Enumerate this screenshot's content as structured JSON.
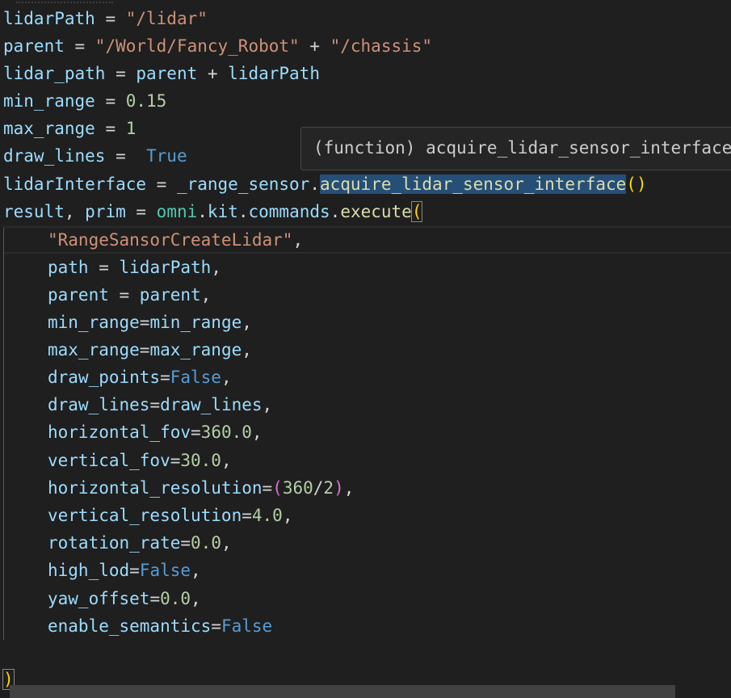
{
  "code": {
    "l1": {
      "var": "lidarPath",
      "eq": " = ",
      "val": "\"/lidar\""
    },
    "l2": {
      "var": "parent",
      "eq": " = ",
      "s1": "\"/World/Fancy_Robot\"",
      "plus": " + ",
      "s2": "\"/chassis\""
    },
    "l3": {
      "var": "lidar_path",
      "eq": " = ",
      "a": "parent",
      "plus": " + ",
      "b": "lidarPath"
    },
    "l4": {
      "var": "min_range",
      "eq": " = ",
      "val": "0.15"
    },
    "l5": {
      "var": "max_range",
      "eq": " = ",
      "val": "1"
    },
    "l6": {
      "var": "draw_lines",
      "eq": " =  ",
      "val": "True"
    },
    "l7": {
      "var": "lidarInterface",
      "eq": " = ",
      "obj": "_range_sensor",
      "dot": ".",
      "fn": "acquire_lidar_sensor_interface",
      "open": "(",
      "close": ")"
    },
    "l8": {
      "a": "result",
      "comma": ", ",
      "b": "prim",
      "eq": " = ",
      "m1": "omni",
      "d1": ".",
      "m2": "kit",
      "d2": ".",
      "m3": "commands",
      "d3": ".",
      "fn": "execute",
      "open": "("
    },
    "l9": {
      "str": "\"RangeSansorCreateLidar\"",
      "comma": ","
    },
    "l10": {
      "key": "path",
      "eq": " = ",
      "val": "lidarPath",
      "comma": ","
    },
    "l11": {
      "key": "parent",
      "eq": " = ",
      "val": "parent",
      "comma": ","
    },
    "l12": {
      "key": "min_range",
      "eq": "=",
      "val": "min_range",
      "comma": ","
    },
    "l13": {
      "key": "max_range",
      "eq": "=",
      "val": "max_range",
      "comma": ","
    },
    "l14": {
      "key": "draw_points",
      "eq": "=",
      "val": "False",
      "comma": ","
    },
    "l15": {
      "key": "draw_lines",
      "eq": "=",
      "val": "draw_lines",
      "comma": ","
    },
    "l16": {
      "key": "horizontal_fov",
      "eq": "=",
      "val": "360.0",
      "comma": ","
    },
    "l17": {
      "key": "vertical_fov",
      "eq": "=",
      "val": "30.0",
      "comma": ","
    },
    "l18": {
      "key": "horizontal_resolution",
      "eq": "=",
      "open": "(",
      "n1": "360",
      "slash": "/",
      "n2": "2",
      "close": ")",
      "comma": ","
    },
    "l19": {
      "key": "vertical_resolution",
      "eq": "=",
      "val": "4.0",
      "comma": ","
    },
    "l20": {
      "key": "rotation_rate",
      "eq": "=",
      "val": "0.0",
      "comma": ","
    },
    "l21": {
      "key": "high_lod",
      "eq": "=",
      "val": "False",
      "comma": ","
    },
    "l22": {
      "key": "yaw_offset",
      "eq": "=",
      "val": "0.0",
      "comma": ","
    },
    "l23": {
      "key": "enable_semantics",
      "eq": "=",
      "val": "False"
    },
    "l24": {
      "close": ")"
    }
  },
  "tooltip": {
    "text": "(function) acquire_lidar_sensor_interface"
  },
  "colors": {
    "background": "#1f1f1f",
    "variable": "#9cdcfe",
    "string": "#ce9178",
    "number": "#b5cea8",
    "keyword": "#569cd6",
    "function": "#dcdcaa",
    "module": "#4ec9b0",
    "bracket_level1": "#ffd700",
    "bracket_level2": "#da70d6"
  }
}
